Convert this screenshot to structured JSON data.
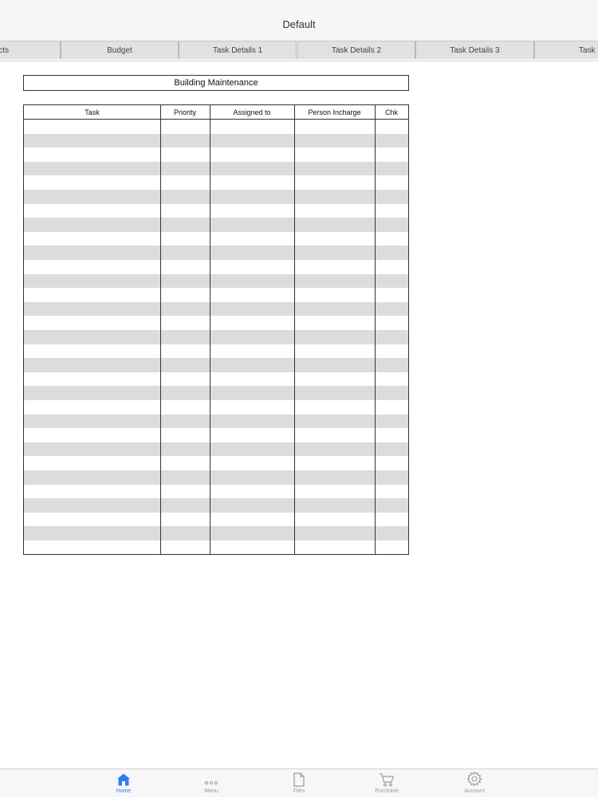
{
  "nav": {
    "title": "Default"
  },
  "tabs": [
    "acts",
    "Budget",
    "Task Details 1",
    "Task Details 2",
    "Task Details 3",
    "Task De"
  ],
  "sheet": {
    "title": "Building Maintenance",
    "columns": [
      "Task",
      "Priority",
      "Assigned to",
      "Person Incharge",
      "Chk"
    ]
  },
  "tabbar": {
    "home": "Home",
    "menu": "Menu",
    "files": "Files",
    "purchase": "Purchase",
    "account": "Account"
  },
  "colors": {
    "accent": "#2f7ef2",
    "row_shade": "#dcdcdf",
    "grid_line": "#333333"
  }
}
